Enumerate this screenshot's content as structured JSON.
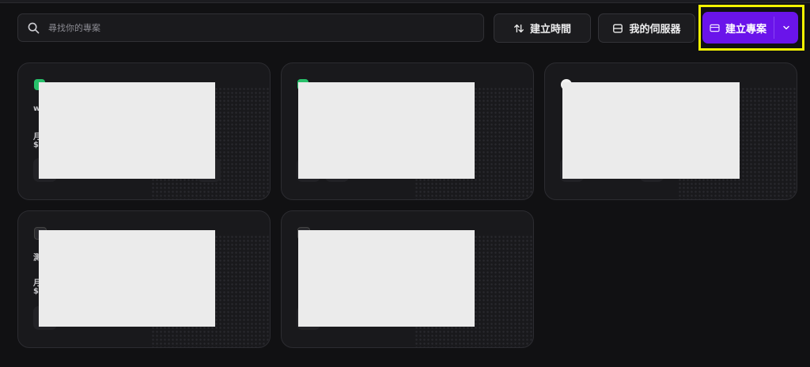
{
  "toolbar": {
    "search_placeholder": "尋找你的專案",
    "sort_label": "建立時間",
    "servers_label": "我的伺服器",
    "create_label": "建立專案"
  },
  "colors": {
    "accent": "#6a14ea",
    "highlight": "#f3f300",
    "status_running": "#27c06a"
  },
  "projects": [
    {
      "name_fragment": "w",
      "line1": "月",
      "line2": "$"
    },
    {
      "name_fragment": "",
      "line1": "",
      "line2": ""
    },
    {
      "name_fragment": "",
      "line1": "",
      "line2": ""
    },
    {
      "name_fragment": "測",
      "line1": "月",
      "line2": "$"
    },
    {
      "name_fragment": "",
      "line1": "",
      "line2": ""
    }
  ]
}
